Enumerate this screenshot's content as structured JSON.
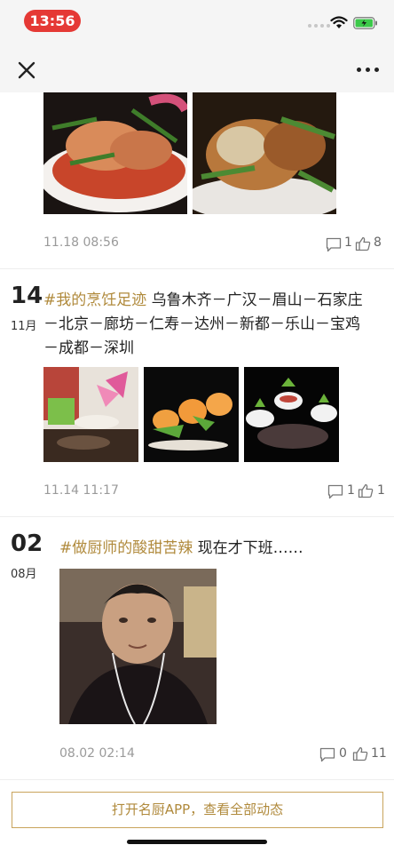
{
  "status_bar": {
    "time": "13:56",
    "accent": "#e53935"
  },
  "nav": {
    "close_icon": "close-icon",
    "more_icon": "more-icon"
  },
  "posts": [
    {
      "time": "11.18 08:56",
      "comments": "1",
      "likes": "8"
    },
    {
      "day": "14",
      "month": "11月",
      "tag": "#我的烹饪足迹",
      "text_line1_rest": " 乌鲁木齐－广汉－眉山－石家庄",
      "text_line2": "－北京－廊坊－仁寿－达州－新都－乐山－宝鸡",
      "text_line3": "－成都－深圳",
      "time": "11.14 11:17",
      "comments": "1",
      "likes": "1"
    },
    {
      "day": "02",
      "month": "08月",
      "tag": "#做厨师的酸甜苦辣",
      "text_rest": " 现在才下班……",
      "time": "08.02 02:14",
      "comments": "0",
      "likes": "11"
    }
  ],
  "cta": {
    "label": "打开名厨APP，查看全部动态",
    "color": "#b08a3c"
  }
}
